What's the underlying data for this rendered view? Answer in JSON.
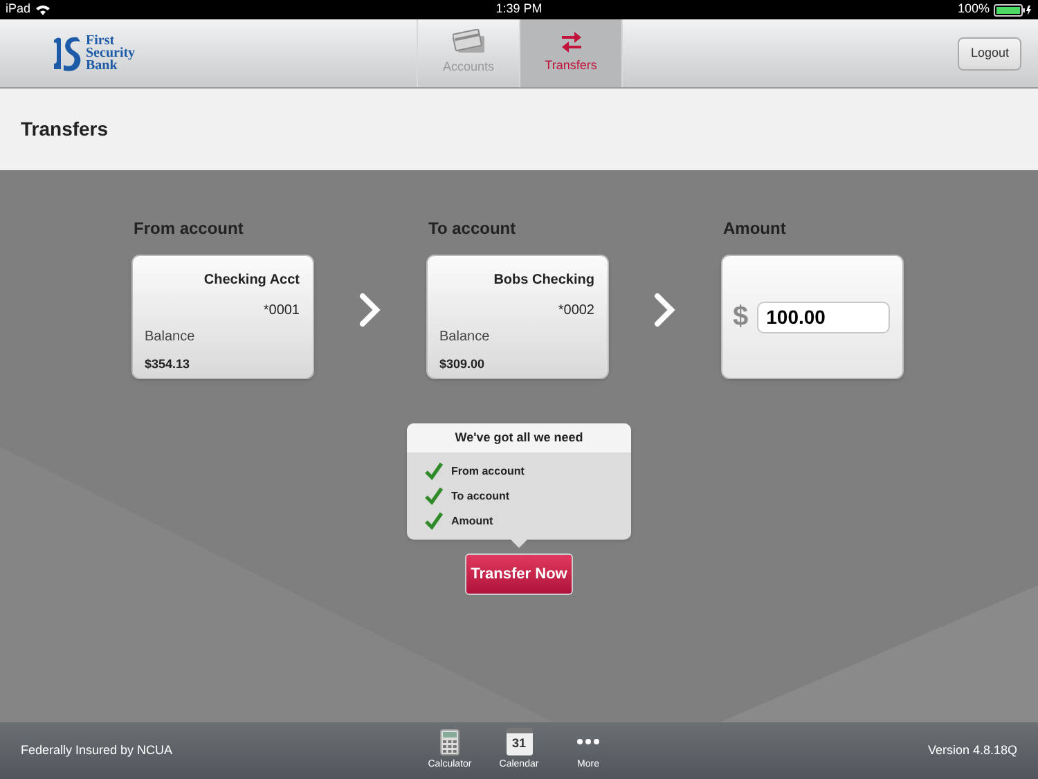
{
  "status_bar": {
    "device": "iPad",
    "time": "1:39 PM",
    "battery": "100%"
  },
  "header": {
    "logo_lines": [
      "First",
      "Security",
      "Bank"
    ],
    "tabs": [
      {
        "label": "Accounts",
        "kind": "accounts",
        "selected": false
      },
      {
        "label": "Transfers",
        "kind": "transfers",
        "selected": true
      }
    ],
    "logout": "Logout"
  },
  "page_title": "Transfers",
  "from_account": {
    "label": "From account",
    "name": "Checking Acct",
    "number": "*0001",
    "balance_label": "Balance",
    "balance": "$354.13"
  },
  "to_account": {
    "label": "To account",
    "name": "Bobs Checking",
    "number": "*0002",
    "balance_label": "Balance",
    "balance": "$309.00"
  },
  "amount": {
    "label": "Amount",
    "currency": "$",
    "value": "100.00"
  },
  "checklist": {
    "title": "We've got all we need",
    "items": [
      {
        "label": "From account",
        "checked": true
      },
      {
        "label": "To account",
        "checked": true
      },
      {
        "label": "Amount",
        "checked": true
      }
    ]
  },
  "transfer_button": "Transfer Now",
  "footer": {
    "notice": "Federally Insured by NCUA",
    "tools": [
      {
        "kind": "calculator",
        "label": "Calculator"
      },
      {
        "kind": "calendar",
        "label": "Calendar",
        "badge": "31"
      },
      {
        "kind": "more",
        "label": "More"
      }
    ],
    "version": "Version 4.8.18Q"
  }
}
